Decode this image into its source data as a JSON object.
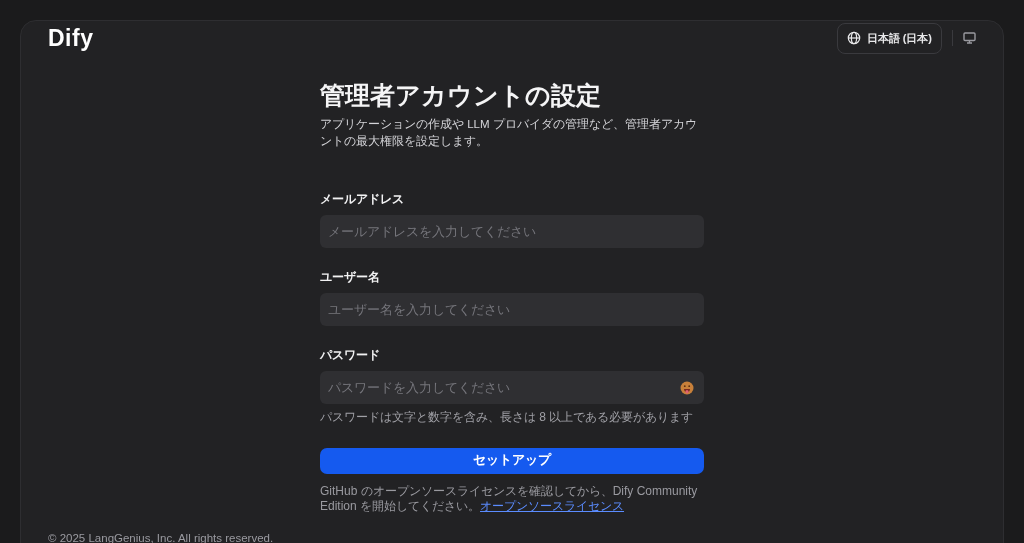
{
  "logo": "Dify",
  "header": {
    "language": "日本語 (日本)"
  },
  "title": "管理者アカウントの設定",
  "description": "アプリケーションの作成や LLM プロバイダの管理など、管理者アカウントの最大権限を設定します。",
  "fields": [
    {
      "kind": "text",
      "label": "メールアドレス",
      "placeholder": "メールアドレスを入力してください"
    },
    {
      "kind": "text",
      "label": "ユーザー名",
      "placeholder": "ユーザー名を入力してください"
    },
    {
      "kind": "password",
      "label": "パスワード",
      "placeholder": "パスワードを入力してください",
      "hint": "パスワードは文字と数字を含み、長さは 8 以上である必要があります"
    }
  ],
  "submit": "セットアップ",
  "notice": {
    "text": "GitHub のオープンソースライセンスを確認してから、Dify Community Edition を開始してください。",
    "link": "オープンソースライセンス"
  },
  "footer": "© 2025 LangGenius, Inc. All rights reserved."
}
